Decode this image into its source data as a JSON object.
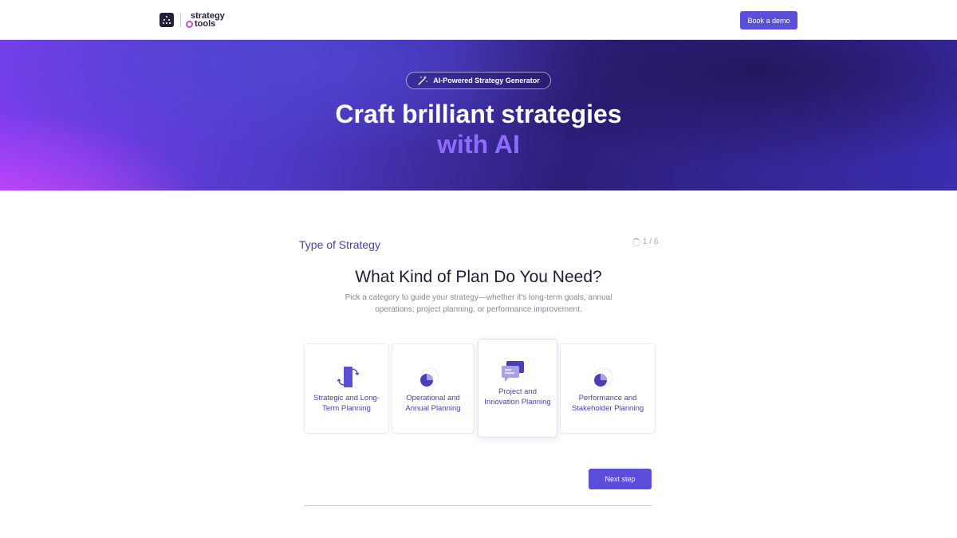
{
  "navbar": {
    "logo_line1": "strategy",
    "logo_line2": "tools",
    "demo_button": "Book a demo"
  },
  "hero": {
    "badge": "AI-Powered Strategy Generator",
    "title": "Craft brilliant strategies",
    "subtitle": "with AI",
    "colors": {
      "accent": "#8d6cff",
      "magenta": "#d648ff",
      "deep": "#2c1f7a"
    }
  },
  "form": {
    "step_label": "Type of Strategy",
    "step_counter": "1 / 6",
    "question": "What Kind of Plan Do You Need?",
    "description": "Pick a category to guide your strategy—whether it's long-term goals, annual operations, project planning, or performance improvement.",
    "options": [
      {
        "label": "Strategic and Long-Term Planning",
        "icon": "long-term-planning-icon"
      },
      {
        "label": "Operational and Annual Planning",
        "icon": "pie-circle-icon"
      },
      {
        "label": "Project and Innovation Planning",
        "icon": "chat-bubbles-icon",
        "selected": true
      },
      {
        "label": "Performance and Stakeholder Planning",
        "icon": "pie-circle-icon"
      }
    ],
    "next_button": "Next step"
  },
  "colors": {
    "primary": "#5b4fd9",
    "text_dark": "#1f1b3a",
    "text_muted": "#8b889c"
  }
}
